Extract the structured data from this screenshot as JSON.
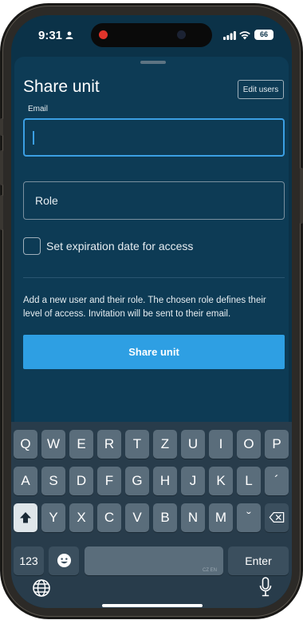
{
  "status_bar": {
    "time": "9:31",
    "battery": "66",
    "icons": [
      "person-icon",
      "record-indicator",
      "camera",
      "signal-icon",
      "wifi-icon",
      "battery-icon"
    ]
  },
  "sheet": {
    "title": "Share unit",
    "edit_users_label": "Edit users",
    "email_label": "Email",
    "email_value": "",
    "role_label": "Role",
    "expiration_label": "Set expiration date for access",
    "expiration_checked": false,
    "help_text": "Add a new user and their role. The chosen role defines their level of access. Invitation will be sent to their email.",
    "share_button_label": "Share unit"
  },
  "keyboard": {
    "row1": [
      "Q",
      "W",
      "E",
      "R",
      "T",
      "Z",
      "U",
      "I",
      "O",
      "P"
    ],
    "row2": [
      "A",
      "S",
      "D",
      "F",
      "G",
      "H",
      "J",
      "K",
      "L",
      "´"
    ],
    "row3": [
      "Y",
      "X",
      "C",
      "V",
      "B",
      "N",
      "M",
      "ˇ"
    ],
    "numbers_label": "123",
    "space_hint": "CZ EN",
    "return_label": "Enter",
    "icons": [
      "shift-icon",
      "backspace-icon",
      "emoji-icon",
      "globe-icon",
      "mic-icon"
    ]
  },
  "colors": {
    "background": "#0b3248",
    "sheet": "#0d3b55",
    "accent": "#2e9fe3",
    "keyboard": "#283c4b"
  }
}
